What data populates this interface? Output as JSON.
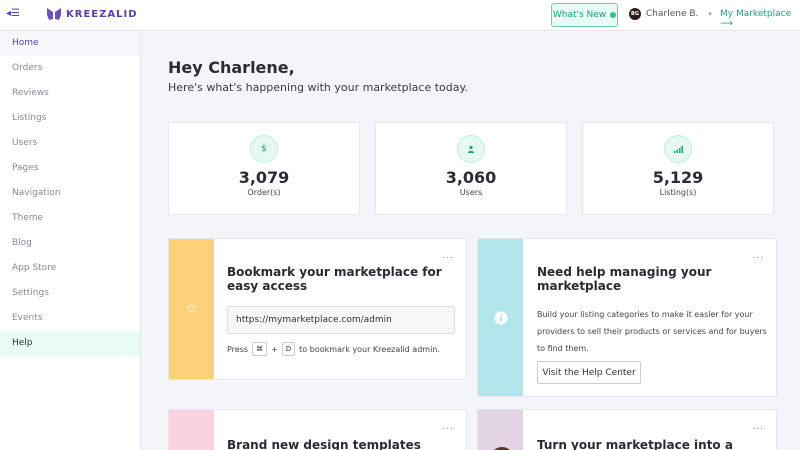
{
  "topbar": {
    "menu_icon": "menu-collapse-icon",
    "logo_text": "KREEZALID",
    "whats_new_label": "What's New",
    "user_initials": "BG",
    "user_name": "Charlene B.",
    "my_marketplace_label": "My Marketplace ⟶"
  },
  "sidebar": {
    "items": [
      {
        "label": "Home"
      },
      {
        "label": "Orders"
      },
      {
        "label": "Reviews"
      },
      {
        "label": "Listings"
      },
      {
        "label": "Users"
      },
      {
        "label": "Pages"
      },
      {
        "label": "Navigation"
      },
      {
        "label": "Theme"
      },
      {
        "label": "Blog"
      },
      {
        "label": "App Store"
      },
      {
        "label": "Settings"
      },
      {
        "label": "Events"
      },
      {
        "label": "Help"
      }
    ]
  },
  "main": {
    "greeting": "Hey Charlene,",
    "subtitle": "Here's what's happening with your marketplace today."
  },
  "stats": [
    {
      "icon": "dollar-icon",
      "value": "3,079",
      "label": "Order(s)"
    },
    {
      "icon": "user-icon",
      "value": "3,060",
      "label": "Users"
    },
    {
      "icon": "signal-bars-icon",
      "value": "5,129",
      "label": "Listing(s)"
    }
  ],
  "cards": {
    "bookmark": {
      "title": "Bookmark your marketplace for easy access",
      "url": "https://mymarketplace.com/admin",
      "press": "Press",
      "key1": "⌘",
      "plus": "+",
      "key2": "D",
      "press_suffix": "to bookmark your Kreezalid admin.",
      "band_color": "#fdd07a"
    },
    "help": {
      "title": "Need help managing your marketplace",
      "text": "Build your listing categories to make it easier for your providers to sell their products or services and for buyers to find them.",
      "button": "Visit the Help Center",
      "band_color": "#b3e6ec"
    },
    "templates": {
      "title": "Brand new design templates",
      "band_color": "#fbd3de"
    },
    "turn": {
      "title": "Turn your marketplace into a"
    },
    "more_label": "..."
  },
  "colors": {
    "brand": "#5a3fa8",
    "accent": "#1aa37c"
  }
}
